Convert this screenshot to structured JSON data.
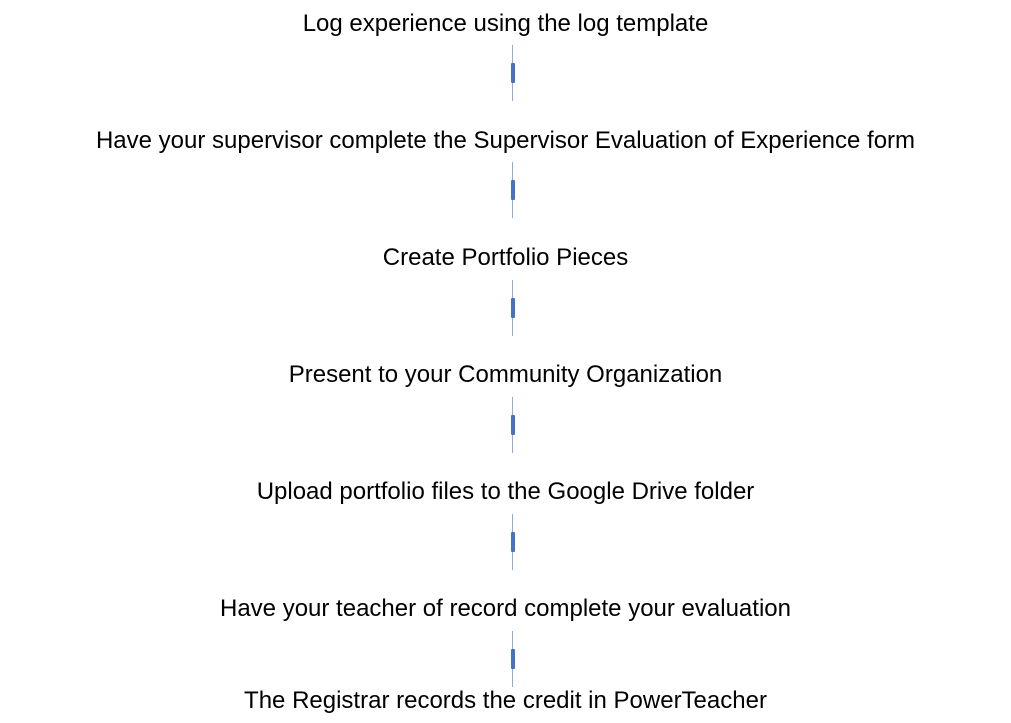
{
  "steps": [
    "Log experience using the log template",
    "Have your supervisor complete the Supervisor Evaluation of Experience form",
    "Create Portfolio Pieces",
    "Present to your Community Organization",
    "Upload portfolio files to the Google Drive folder",
    "Have your teacher of record complete your evaluation",
    "The Registrar records the credit in PowerTeacher"
  ],
  "colors": {
    "text": "#000000",
    "connector_line": "#8faadc",
    "connector_mark": "#4472c4"
  }
}
